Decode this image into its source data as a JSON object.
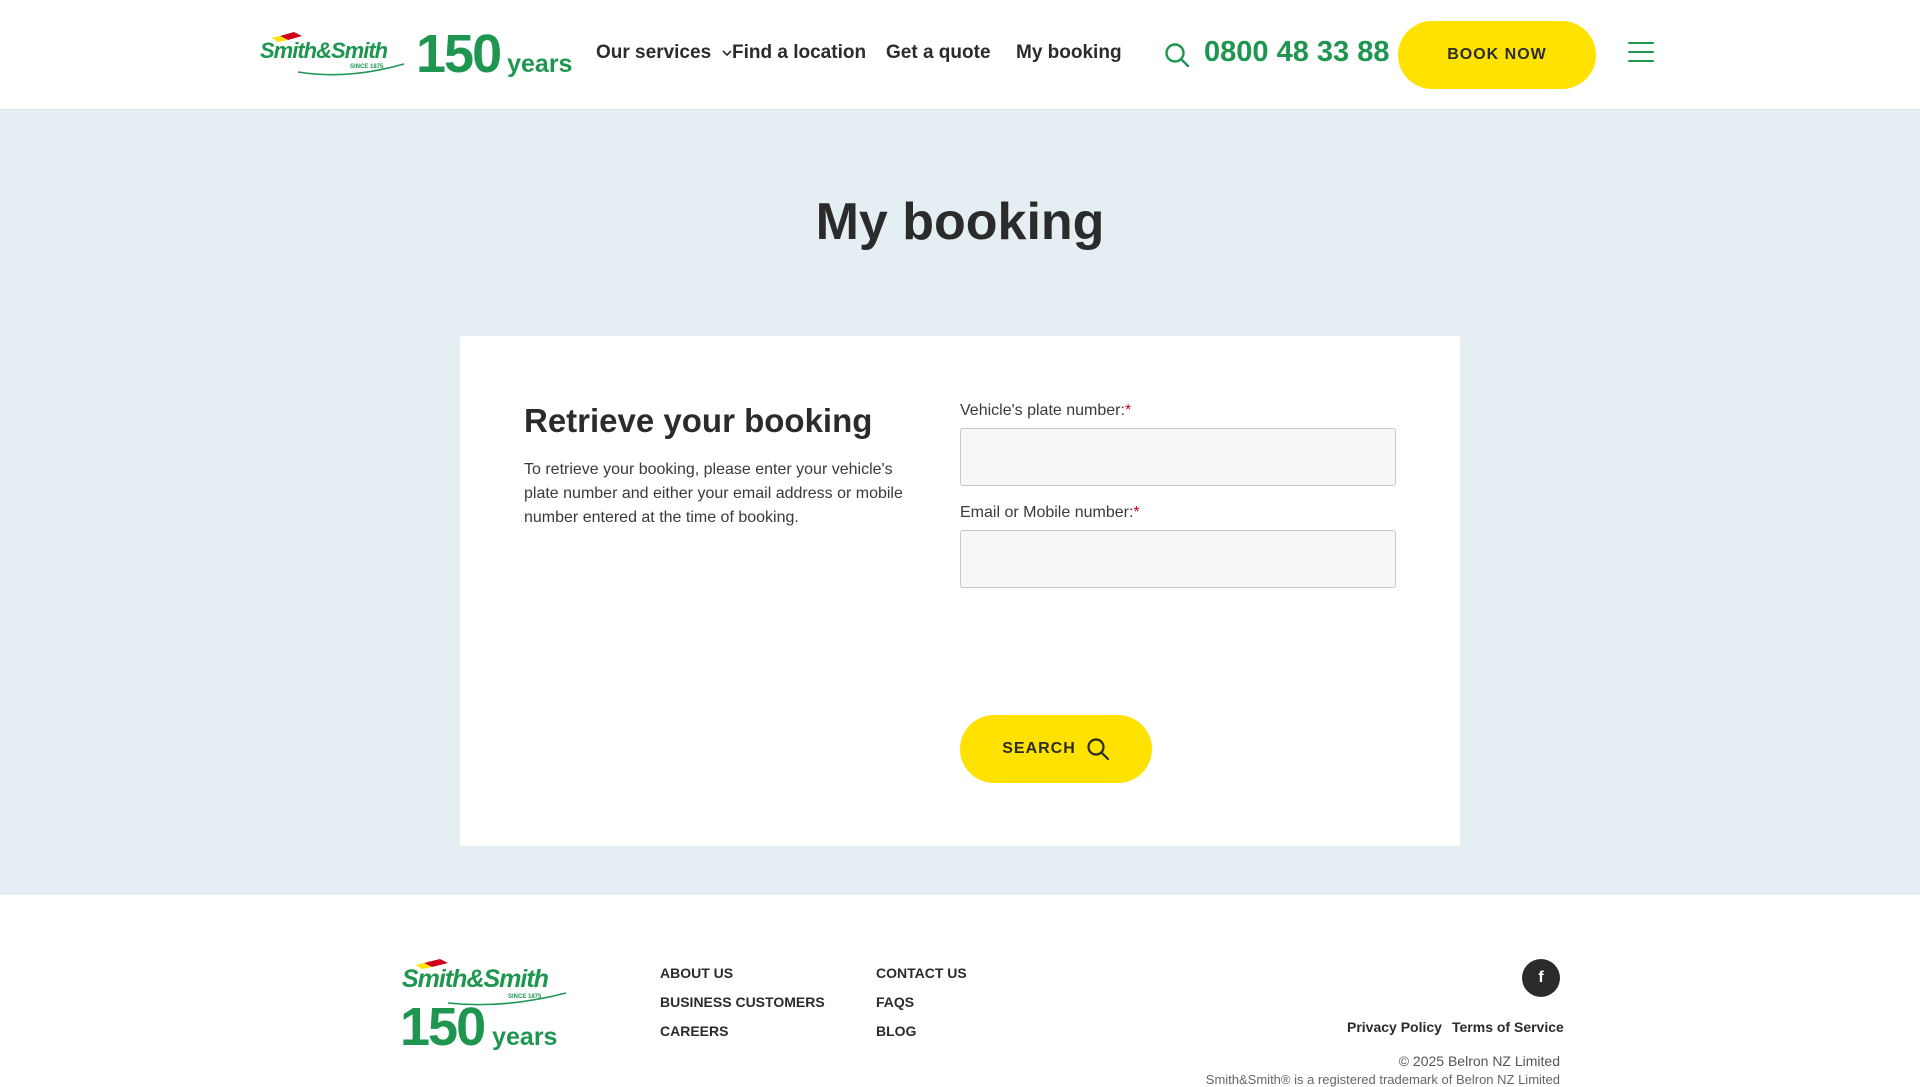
{
  "brand": {
    "logo_text": "Smith&Smith",
    "logo_since": "SINCE 1875",
    "anniversary_number": "150",
    "anniversary_word": "years",
    "green": "#1e9650",
    "yellow": "#ffe200",
    "red": "#d0021b"
  },
  "nav": {
    "items": [
      {
        "label": "Our services",
        "has_dropdown": true
      },
      {
        "label": "Find a location"
      },
      {
        "label": "Get a quote"
      },
      {
        "label": "My booking"
      }
    ],
    "search_icon": "search-icon",
    "phone": "0800 48 33 88",
    "book_now": "BOOK NOW",
    "menu_icon": "hamburger-menu-icon"
  },
  "page": {
    "title": "My booking"
  },
  "form": {
    "title": "Retrieve your booking",
    "description": "To retrieve your booking, please enter your vehicle's plate number and either your email address or mobile number entered at the time of booking.",
    "plate_label": "Vehicle's plate number:",
    "plate_value": "",
    "contact_label": "Email or Mobile number:",
    "contact_value": "",
    "required_mark": "*",
    "submit_label": "SEARCH"
  },
  "footer": {
    "col1": [
      "ABOUT US",
      "BUSINESS CUSTOMERS",
      "CAREERS"
    ],
    "col2": [
      "CONTACT US",
      "FAQS",
      "BLOG"
    ],
    "social_icon": "facebook-icon",
    "social_glyph": "f",
    "legal": [
      "Privacy Policy",
      "Terms of Service"
    ],
    "copyright": "© 2025 Belron NZ Limited",
    "trademark": "Smith&Smith® is a registered trademark of Belron NZ Limited"
  }
}
